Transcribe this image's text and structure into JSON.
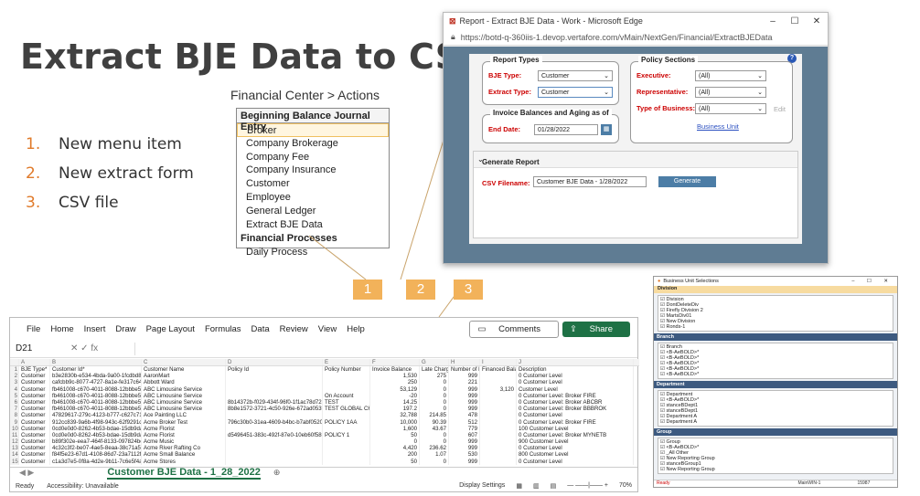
{
  "slide": {
    "title": "Extract BJE Data to CSV",
    "list": [
      {
        "num": "1.",
        "text": "New menu item"
      },
      {
        "num": "2.",
        "text": "New extract form"
      },
      {
        "num": "3.",
        "text": "CSV file"
      }
    ],
    "callouts": [
      "1",
      "2",
      "3"
    ]
  },
  "financial_center": {
    "caption": "Financial Center > Actions",
    "header": "Beginning Balance Journal Entry",
    "items": [
      "Broker",
      "Company Brokerage",
      "Company Fee",
      "Company Insurance",
      "Customer",
      "Employee",
      "General Ledger",
      "Extract BJE Data"
    ],
    "sub_header": "Financial Processes",
    "sub_items": [
      "Daily Process"
    ]
  },
  "edge": {
    "title": "Report - Extract BJE Data - Work - Microsoft Edge",
    "url": "https://botd-q-360iis-1.devop.vertafore.com/vMain/NextGen/Financial/ExtractBJEData",
    "controls": [
      "–",
      "☐",
      "✕"
    ],
    "report_types": {
      "legend": "Report Types",
      "bje_type_label": "BJE Type:",
      "bje_type_value": "Customer",
      "extract_type_label": "Extract Type:",
      "extract_type_value": "Customer"
    },
    "invoice": {
      "legend": "Invoice Balances and Aging as of",
      "end_date_label": "End Date:",
      "end_date_value": "01/28/2022"
    },
    "policy": {
      "legend": "Policy Sections",
      "executive_label": "Executive:",
      "executive_value": "(All)",
      "representative_label": "Representative:",
      "representative_value": "(All)",
      "type_label": "Type of Business:",
      "type_value": "(All)",
      "edit_label": "Edit",
      "business_unit_link": "Business Unit"
    },
    "generate": {
      "title": "Generate Report",
      "csv_label": "CSV Filename:",
      "csv_value": "Customer BJE Data - 1/28/2022",
      "button": "Generate"
    }
  },
  "excel": {
    "menu": [
      "File",
      "Home",
      "Insert",
      "Draw",
      "Page Layout",
      "Formulas",
      "Data",
      "Review",
      "View",
      "Help"
    ],
    "comments": "Comments",
    "share": "Share",
    "cell_ref": "D21",
    "columns": [
      "A",
      "B",
      "C",
      "D",
      "E",
      "F",
      "G",
      "H",
      "I",
      "J"
    ],
    "header_row": [
      "BJE Type*",
      "Customer Id*",
      "Customer Name",
      "Policy Id",
      "Policy Number",
      "Invoice Balance",
      "Late Charge Bal",
      "Number of Days",
      "Financed Balance",
      "Description"
    ],
    "rows": [
      [
        "Customer",
        "b3e2830b-e534-4bda-9a00-1fcdbd8403bd",
        "AaronMart",
        "",
        "",
        "1,530",
        "275",
        "999",
        "",
        "0 Customer Level"
      ],
      [
        "Customer",
        "cafcbb9c-8077-4727-8a1e-fe317c643b32",
        "Abbott Ward",
        "",
        "",
        "250",
        "0",
        "221",
        "",
        "0 Customer Level"
      ],
      [
        "Customer",
        "fb461008-c670-4011-8088-12bbbe578498",
        "ABC Limousine Service",
        "",
        "",
        "53,129",
        "0",
        "999",
        "3,120",
        "Customer Level"
      ],
      [
        "Customer",
        "fb461008-c670-4011-8088-12bbbe578498",
        "ABC Limousine Service",
        "",
        "On Account",
        "-20",
        "0",
        "999",
        "",
        "0 Customer Level: Broker FIRE"
      ],
      [
        "Customer",
        "fb461008-c670-4011-8088-12bbbe578498",
        "ABC Limousine Service",
        "8b14372b-f029-434f-96f0-1f1ac78d7257",
        "TEST",
        "14.25",
        "0",
        "999",
        "",
        "0 Customer Level: Broker ABCBR"
      ],
      [
        "Customer",
        "fb461008-c670-4011-8088-12bbbe578498",
        "ABC Limousine Service",
        "8b8e1572-3721-4c50-926e-672ad053fa57",
        "TEST GLOBAL CHANGE",
        "197.2",
        "0",
        "999",
        "",
        "0 Customer Level: Broker BBBROK"
      ],
      [
        "Customer",
        "47829617-279c-4123-b777-c627c71617da",
        "Ace Painting LLC",
        "",
        "",
        "32,788",
        "214.85",
        "478",
        "",
        "0 Customer Level"
      ],
      [
        "Customer",
        "912cc839-9a6b-4f98-943c-62f9291d7ce0",
        "Acme Broker Test",
        "796c30b0-31ea-4609-b4bc-b7abf0520249",
        "POLICY 1AA",
        "10,000",
        "90.39",
        "512",
        "",
        "0 Customer Level: Broker FIRE"
      ],
      [
        "Customer",
        "0cd0e0d0-8262-4b53-bdae-15db9daa7d29",
        "Acme Florist",
        "",
        "",
        "1,600",
        "43.67",
        "779",
        "",
        "100 Customer Level"
      ],
      [
        "Customer",
        "0cd0e0d0-8262-4b53-bdae-15db9daa7d29",
        "Acme Florist",
        "d5496451-383c-492f-87e0-10eb60f5893f",
        "POLICY 1",
        "50",
        "0",
        "607",
        "",
        "0 Customer Level: Broker MYNETB"
      ],
      [
        "Customer",
        "b89f302e-eea7-464f-8133-097824be50dc",
        "Acme Music",
        "",
        "",
        "0",
        "0",
        "999",
        "",
        "900 Customer Level"
      ],
      [
        "Customer",
        "4c32c3f2-be07-4ae5-8eaa-38c71a56dfa",
        "Acme River Rafting Co",
        "",
        "",
        "4,420",
        "236.62",
        "999",
        "",
        "0 Customer Level"
      ],
      [
        "Customer",
        "f84f5e23-67d1-4108-86d7-23a7112f3a93",
        "Acme Small Balance",
        "",
        "",
        "200",
        "1.07",
        "530",
        "",
        "800 Customer Level"
      ],
      [
        "Customer",
        "c1a3d7e5-0f8a-4d2e-9b11-7c6e5f4a3b21",
        "Acme Stores",
        "",
        "",
        "50",
        "0",
        "999",
        "",
        "0 Customer Level"
      ]
    ],
    "sheet_name": "Customer BJE Data - 1_28_2022",
    "status_ready": "Ready",
    "accessibility": "Accessibility: Unavailable",
    "display_settings": "Display Settings",
    "zoom": "70%"
  },
  "business_unit": {
    "title": "Business Unit Selections",
    "tab": "Division",
    "sections": [
      "Branch",
      "Department",
      "Group"
    ],
    "division_rows": [
      "Division",
      "DontDeleteDiv",
      "Firefly Division 2",
      "MartsDiv01",
      "New Division",
      "Ronds-1"
    ],
    "branch_rows": [
      "Branch",
      "<B-AeBOLD>*",
      "<B-AeBOLD>*",
      "<B-AeBOLD>*",
      "<B-AeBOLD>*",
      "<B-AeBOLD>*"
    ],
    "department_rows": [
      "Department",
      "<B-AeBOLD>*",
      "stanceBDept1",
      "stanceBDept1",
      "Department A",
      "Department A"
    ],
    "group_rows": [
      "Group",
      "<B-AeBOLD>*",
      "_All Other",
      "New Reporting Group",
      "stanceBGroup1",
      "New Reporting Group"
    ],
    "status_left": "Ready",
    "status_mid": "MainWIN-1",
    "status_right": "15987"
  }
}
